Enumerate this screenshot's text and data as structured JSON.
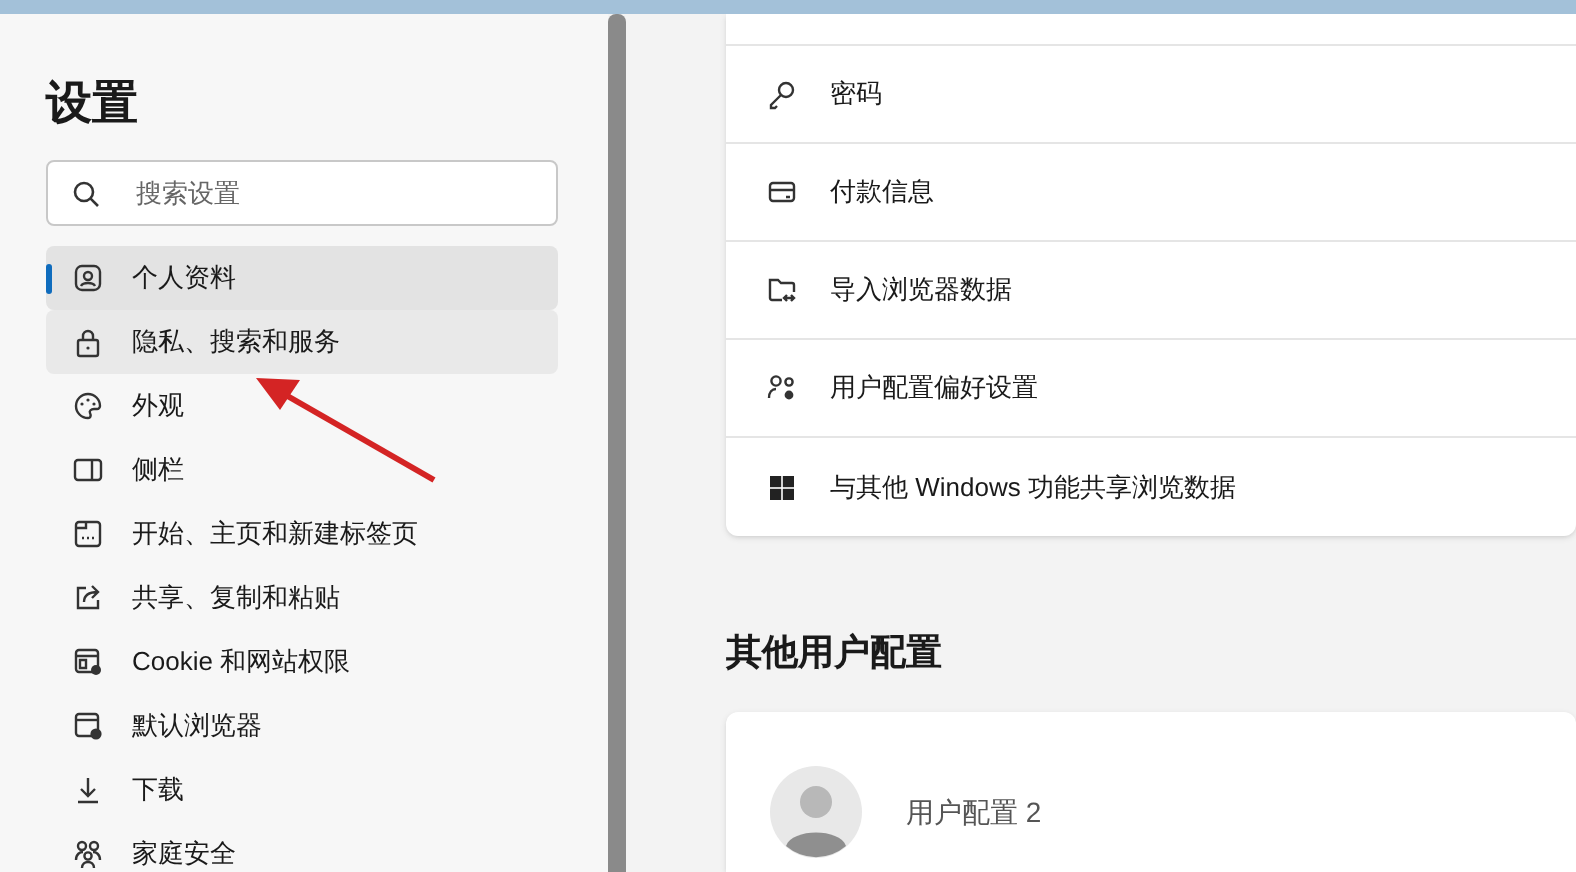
{
  "sidebar": {
    "title": "设置",
    "search": {
      "placeholder": "搜索设置"
    },
    "items": [
      {
        "label": "个人资料",
        "selected": true,
        "hovered": false
      },
      {
        "label": "隐私、搜索和服务",
        "selected": false,
        "hovered": true
      },
      {
        "label": "外观",
        "selected": false,
        "hovered": false
      },
      {
        "label": "侧栏",
        "selected": false,
        "hovered": false
      },
      {
        "label": "开始、主页和新建标签页",
        "selected": false,
        "hovered": false
      },
      {
        "label": "共享、复制和粘贴",
        "selected": false,
        "hovered": false
      },
      {
        "label": "Cookie 和网站权限",
        "selected": false,
        "hovered": false
      },
      {
        "label": "默认浏览器",
        "selected": false,
        "hovered": false
      },
      {
        "label": "下载",
        "selected": false,
        "hovered": false
      },
      {
        "label": "家庭安全",
        "selected": false,
        "hovered": false
      }
    ]
  },
  "profile_settings": [
    {
      "label": "密码"
    },
    {
      "label": "付款信息"
    },
    {
      "label": "导入浏览器数据"
    },
    {
      "label": "用户配置偏好设置"
    },
    {
      "label": "与其他 Windows 功能共享浏览数据"
    }
  ],
  "other_profiles": {
    "heading": "其他用户配置",
    "profiles": [
      {
        "name": "用户配置 2"
      }
    ]
  }
}
